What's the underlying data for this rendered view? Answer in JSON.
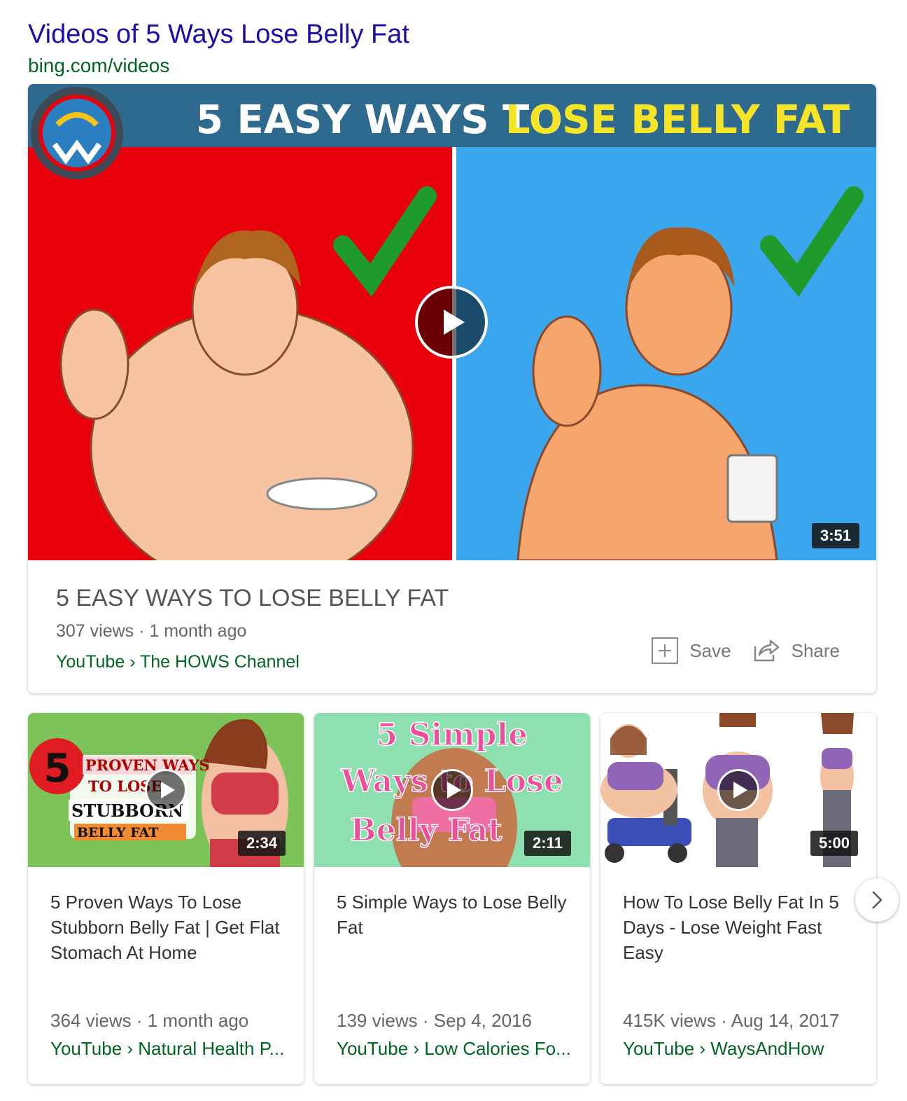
{
  "header": {
    "title": "Videos of 5 Ways Lose Belly Fat",
    "source": "bing.com/videos"
  },
  "featured": {
    "thumbnail_text_white": "5 EASY WAYS TO",
    "thumbnail_text_yellow": "LOSE BELLY FAT",
    "duration": "3:51",
    "title": "5 EASY WAYS TO LOSE BELLY FAT",
    "meta": "307 views · 1 month ago",
    "channel": "YouTube › The HOWS Channel",
    "save_label": "Save",
    "share_label": "Share"
  },
  "cards": [
    {
      "thumb_badge": "5",
      "thumb_lines": [
        "PROVEN WAYS",
        "TO LOSE",
        "STUBBORN",
        "BELLY FAT"
      ],
      "duration": "2:34",
      "title": "5 Proven Ways To Lose Stubborn Belly Fat | Get Flat Stomach At Home",
      "meta": "364 views · 1 month ago",
      "channel": "YouTube › Natural Health P..."
    },
    {
      "thumb_lines": [
        "5 Simple",
        "Ways to Lose",
        "Belly Fat"
      ],
      "duration": "2:11",
      "title": "5 Simple Ways to Lose Belly Fat",
      "meta": "139 views · Sep 4, 2016",
      "channel": "YouTube › Low Calories Fo..."
    },
    {
      "duration": "5:00",
      "title": "How To Lose Belly Fat In 5 Days - Lose Weight Fast Easy",
      "meta": "415K views · Aug 14, 2017",
      "channel": "YouTube › WaysAndHow"
    }
  ],
  "colors": {
    "link": "#1a0dab",
    "url_green": "#006621",
    "thumb_red": "#e8000b",
    "thumb_blue": "#3aa6ee",
    "banner": "#2d6a8e",
    "banner_yellow": "#f5e526"
  }
}
